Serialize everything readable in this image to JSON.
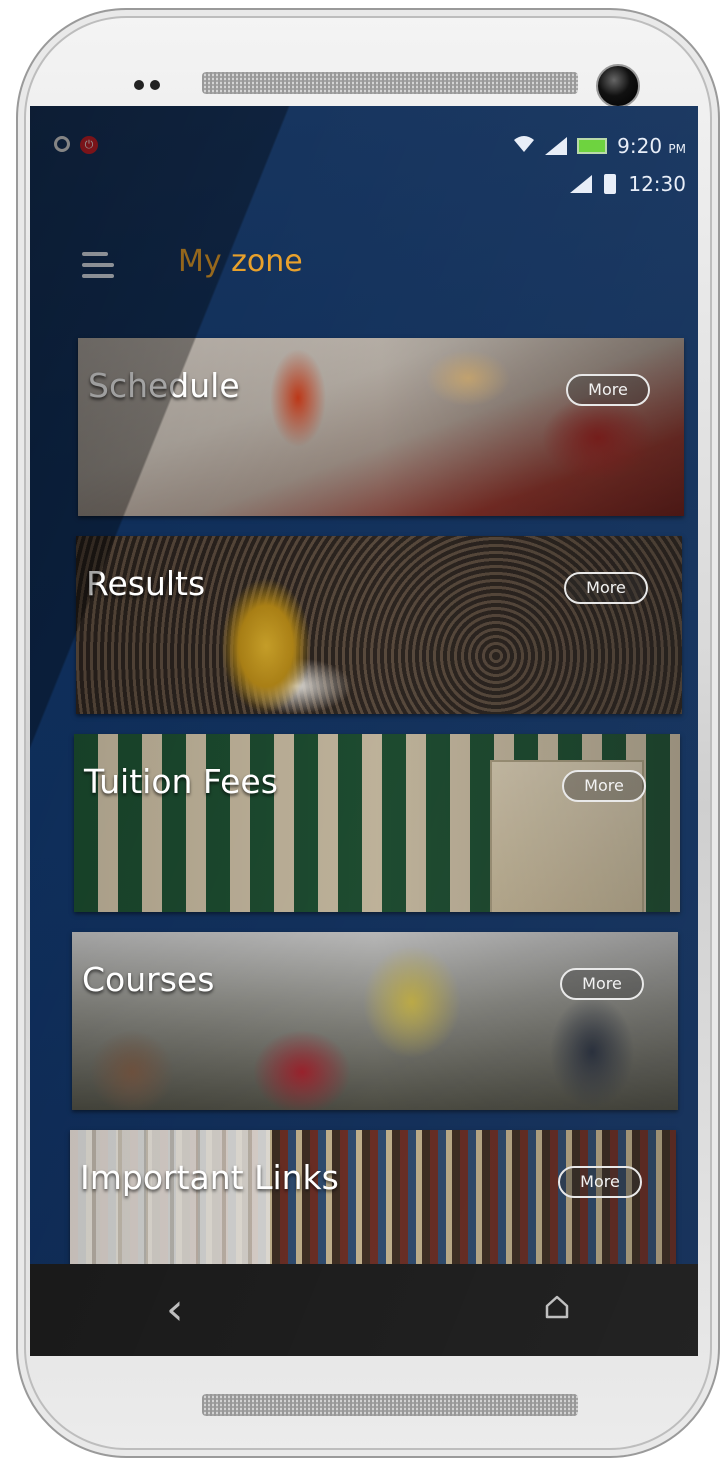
{
  "status_bar": {
    "time": "9:20",
    "ampm": "PM",
    "secondary_time": "12:30",
    "icons": [
      "ring-icon",
      "record-icon",
      "wifi-icon",
      "signal-icon",
      "battery-icon"
    ]
  },
  "app_bar": {
    "title": "My zone",
    "menu_icon": "hamburger-menu-icon",
    "title_color": "#e8a12c"
  },
  "cards": [
    {
      "title": "Schedule",
      "more_label": "More"
    },
    {
      "title": "Results",
      "more_label": "More"
    },
    {
      "title": "Tuition Fees",
      "more_label": "More"
    },
    {
      "title": "Courses",
      "more_label": "More"
    },
    {
      "title": "Important Links",
      "more_label": "More"
    }
  ],
  "nav_bar": {
    "back_icon": "back-icon",
    "home_icon": "home-icon"
  },
  "colors": {
    "background": "#102f5a",
    "accent": "#e8a12c",
    "navbar": "#171717"
  }
}
